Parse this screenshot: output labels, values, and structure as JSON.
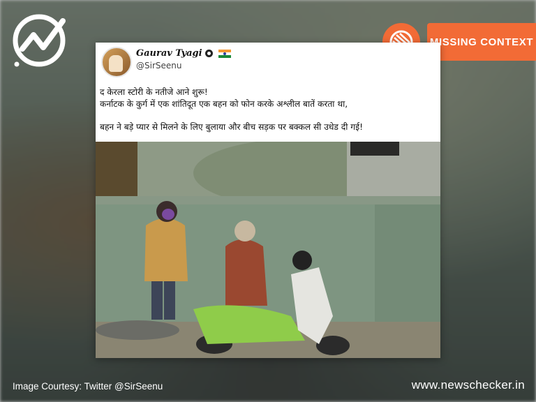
{
  "brand": {
    "logo_icon": "newschecker-logo-icon",
    "seal_icon": "missing-context-seal-icon"
  },
  "badge": {
    "label": "MISSING CONTEXT",
    "color": "#f26b36"
  },
  "tweet": {
    "author": "Gaurav Tyagi",
    "handle": "@SirSeenu",
    "lines": [
      "द केरला स्टोरी के नतीजे आने शुरू!",
      "कर्नाटक के कुर्ग में एक शांतिदूत एक बहन को फोन करके अश्लील बातें करता था,",
      "बहन ने बड़े प्यार से मिलने के लिए बुलाया और बीच सड़क पर बक्कल सी उधेड दी गई!"
    ]
  },
  "footer": {
    "credit": "Image Courtesy: Twitter @SirSeenu",
    "site": "www.newschecker.in"
  }
}
